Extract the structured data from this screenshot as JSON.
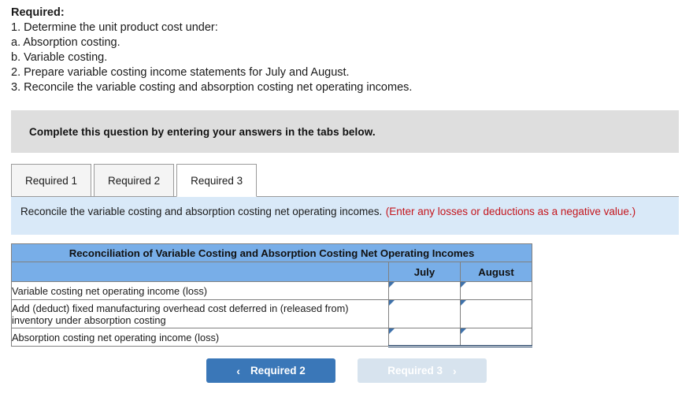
{
  "requirements": {
    "heading": "Required:",
    "lines": [
      "1. Determine the unit product cost under:",
      "a. Absorption costing.",
      "b. Variable costing.",
      "2. Prepare variable costing income statements for July and August.",
      "3. Reconcile the variable costing and absorption costing net operating incomes."
    ]
  },
  "complete_banner": {
    "text": "Complete this question by entering your answers in the tabs below."
  },
  "tabs": [
    {
      "label": "Required 1",
      "active": false
    },
    {
      "label": "Required 2",
      "active": false
    },
    {
      "label": "Required 3",
      "active": true
    }
  ],
  "instruction": {
    "main": "Reconcile the variable costing and absorption costing net operating incomes.",
    "note": "(Enter any losses or deductions as a negative value.)",
    "note_color": "#c4151c"
  },
  "table": {
    "title": "Reconciliation of Variable Costing and Absorption Costing Net Operating Incomes",
    "header_blank": "",
    "columns": [
      "July",
      "August"
    ],
    "header_bg": "#78aee8",
    "rows": [
      {
        "label": "Variable costing net operating income (loss)",
        "july": "",
        "august": ""
      },
      {
        "label": "Add (deduct) fixed manufacturing overhead cost deferred in (released from) inventory under absorption costing",
        "july": "",
        "august": ""
      },
      {
        "label": "Absorption costing net operating income (loss)",
        "july": "",
        "august": ""
      }
    ]
  },
  "nav": {
    "prev_label": "Required 2",
    "prev_chevron": "‹",
    "next_label": "Required 3",
    "next_chevron": "›",
    "prev_color": "#3a77b8",
    "next_color": "#d7e3ee"
  }
}
